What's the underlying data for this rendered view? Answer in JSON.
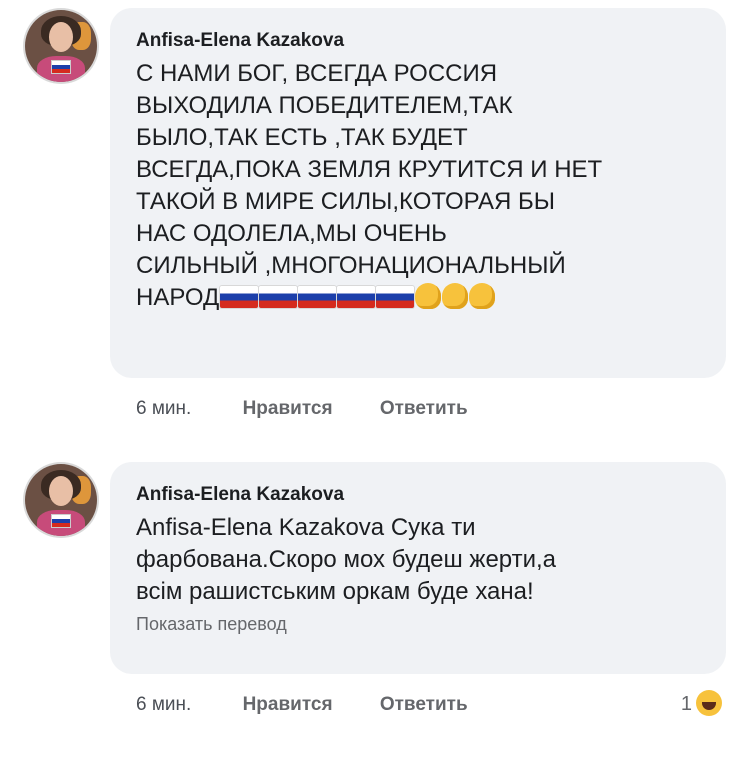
{
  "comments": [
    {
      "author": "Anfisa-Elena Kazakova",
      "lines": [
        "С НАМИ БОГ, ВСЕГДА РОССИЯ",
        "ВЫХОДИЛА ПОБЕДИТЕЛЕМ,ТАК",
        "БЫЛО,ТАК ЕСТЬ ,ТАК БУДЕТ",
        "ВСЕГДА,ПОКА ЗЕМЛЯ КРУТИТСЯ И НЕТ",
        "ТАКОЙ В МИРЕ СИЛЫ,КОТОРАЯ БЫ",
        "НАС ОДОЛЕЛА,МЫ ОЧЕНЬ",
        "СИЛЬНЫЙ ,МНОГОНАЦИОНАЛЬНЫЙ",
        "НАРОД"
      ],
      "emojis": [
        "russia-flag",
        "russia-flag",
        "russia-flag",
        "russia-flag",
        "russia-flag",
        "fist",
        "fist",
        "fist"
      ],
      "time": "6 мин.",
      "like": "Нравится",
      "reply": "Ответить"
    },
    {
      "author": "Anfisa-Elena Kazakova",
      "lines": [
        "Anfisa-Elena Kazakova Сука ти",
        "фарбована.Скоро мох будеш жерти,а",
        "всім рашистським оркам буде хана!"
      ],
      "translate": "Показать перевод",
      "time": "6 мин.",
      "like": "Нравится",
      "reply": "Ответить",
      "reaction_count": "1",
      "reaction_icon": "laughing-emoji"
    }
  ],
  "colors": {
    "bubble": "#f0f2f5",
    "meta": "#65676b"
  }
}
